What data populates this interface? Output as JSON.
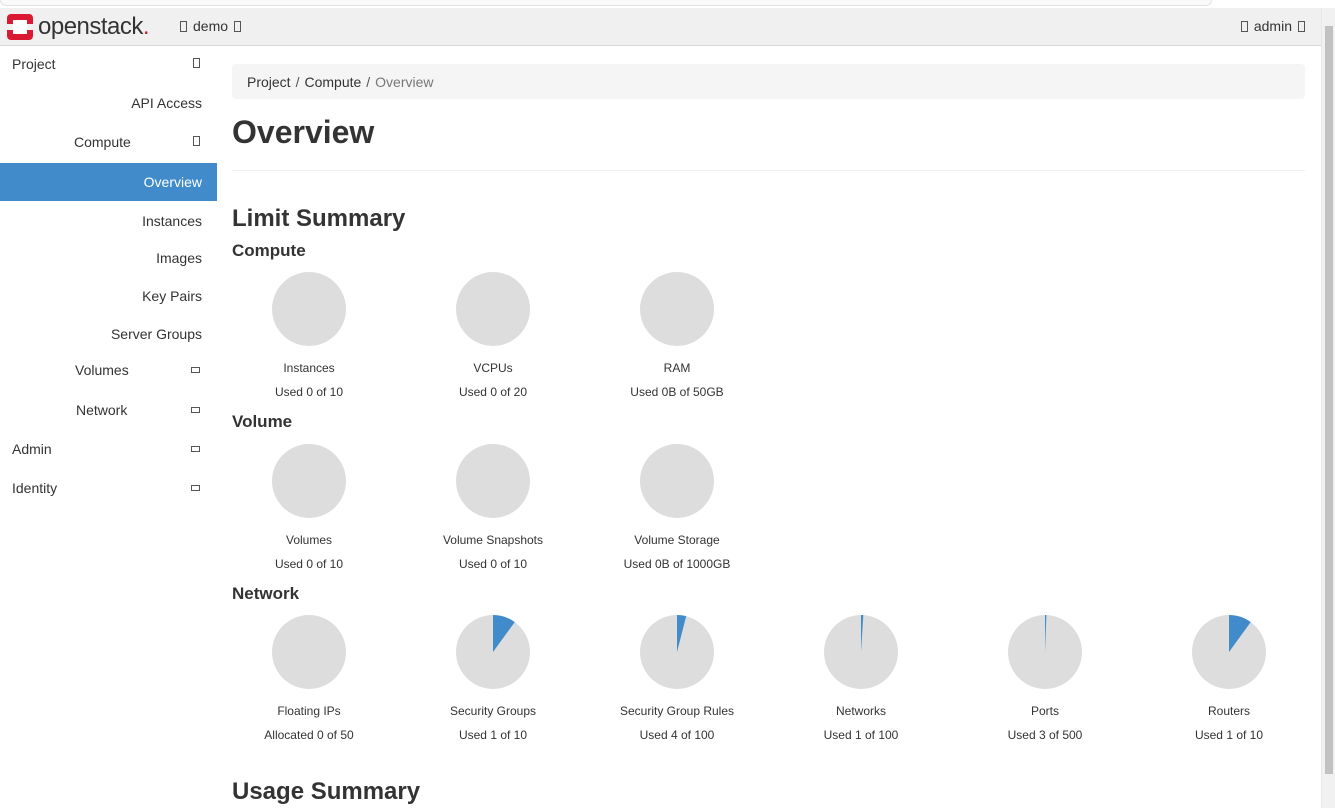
{
  "header": {
    "brand": "openstack",
    "project": "demo",
    "user": "admin"
  },
  "sidebar": {
    "project": "Project",
    "api_access": "API Access",
    "compute": "Compute",
    "overview": "Overview",
    "instances": "Instances",
    "images": "Images",
    "key_pairs": "Key Pairs",
    "server_groups": "Server Groups",
    "volumes": "Volumes",
    "network": "Network",
    "admin": "Admin",
    "identity": "Identity"
  },
  "breadcrumb": {
    "project": "Project",
    "sep": "/",
    "compute": "Compute",
    "current": "Overview"
  },
  "page_title": "Overview",
  "limit_summary": {
    "heading": "Limit Summary",
    "compute_heading": "Compute",
    "volume_heading": "Volume",
    "network_heading": "Network"
  },
  "usage_summary": {
    "heading": "Usage Summary"
  },
  "colors": {
    "accent": "#428bca",
    "pie_bg": "#dddddd",
    "brand_red": "#da1a32"
  },
  "chart_data": [
    {
      "type": "pie",
      "group": "Compute",
      "title": "Instances",
      "text": "Used 0 of 10",
      "used": 0,
      "total": 10
    },
    {
      "type": "pie",
      "group": "Compute",
      "title": "VCPUs",
      "text": "Used 0 of 20",
      "used": 0,
      "total": 20
    },
    {
      "type": "pie",
      "group": "Compute",
      "title": "RAM",
      "text": "Used 0B of 50GB",
      "used": 0,
      "total": 50
    },
    {
      "type": "pie",
      "group": "Volume",
      "title": "Volumes",
      "text": "Used 0 of 10",
      "used": 0,
      "total": 10
    },
    {
      "type": "pie",
      "group": "Volume",
      "title": "Volume Snapshots",
      "text": "Used 0 of 10",
      "used": 0,
      "total": 10
    },
    {
      "type": "pie",
      "group": "Volume",
      "title": "Volume Storage",
      "text": "Used 0B of 1000GB",
      "used": 0,
      "total": 1000
    },
    {
      "type": "pie",
      "group": "Network",
      "title": "Floating IPs",
      "text": "Allocated 0 of 50",
      "used": 0,
      "total": 50
    },
    {
      "type": "pie",
      "group": "Network",
      "title": "Security Groups",
      "text": "Used 1 of 10",
      "used": 1,
      "total": 10
    },
    {
      "type": "pie",
      "group": "Network",
      "title": "Security Group Rules",
      "text": "Used 4 of 100",
      "used": 4,
      "total": 100
    },
    {
      "type": "pie",
      "group": "Network",
      "title": "Networks",
      "text": "Used 1 of 100",
      "used": 1,
      "total": 100
    },
    {
      "type": "pie",
      "group": "Network",
      "title": "Ports",
      "text": "Used 3 of 500",
      "used": 3,
      "total": 500
    },
    {
      "type": "pie",
      "group": "Network",
      "title": "Routers",
      "text": "Used 1 of 10",
      "used": 1,
      "total": 10
    }
  ]
}
